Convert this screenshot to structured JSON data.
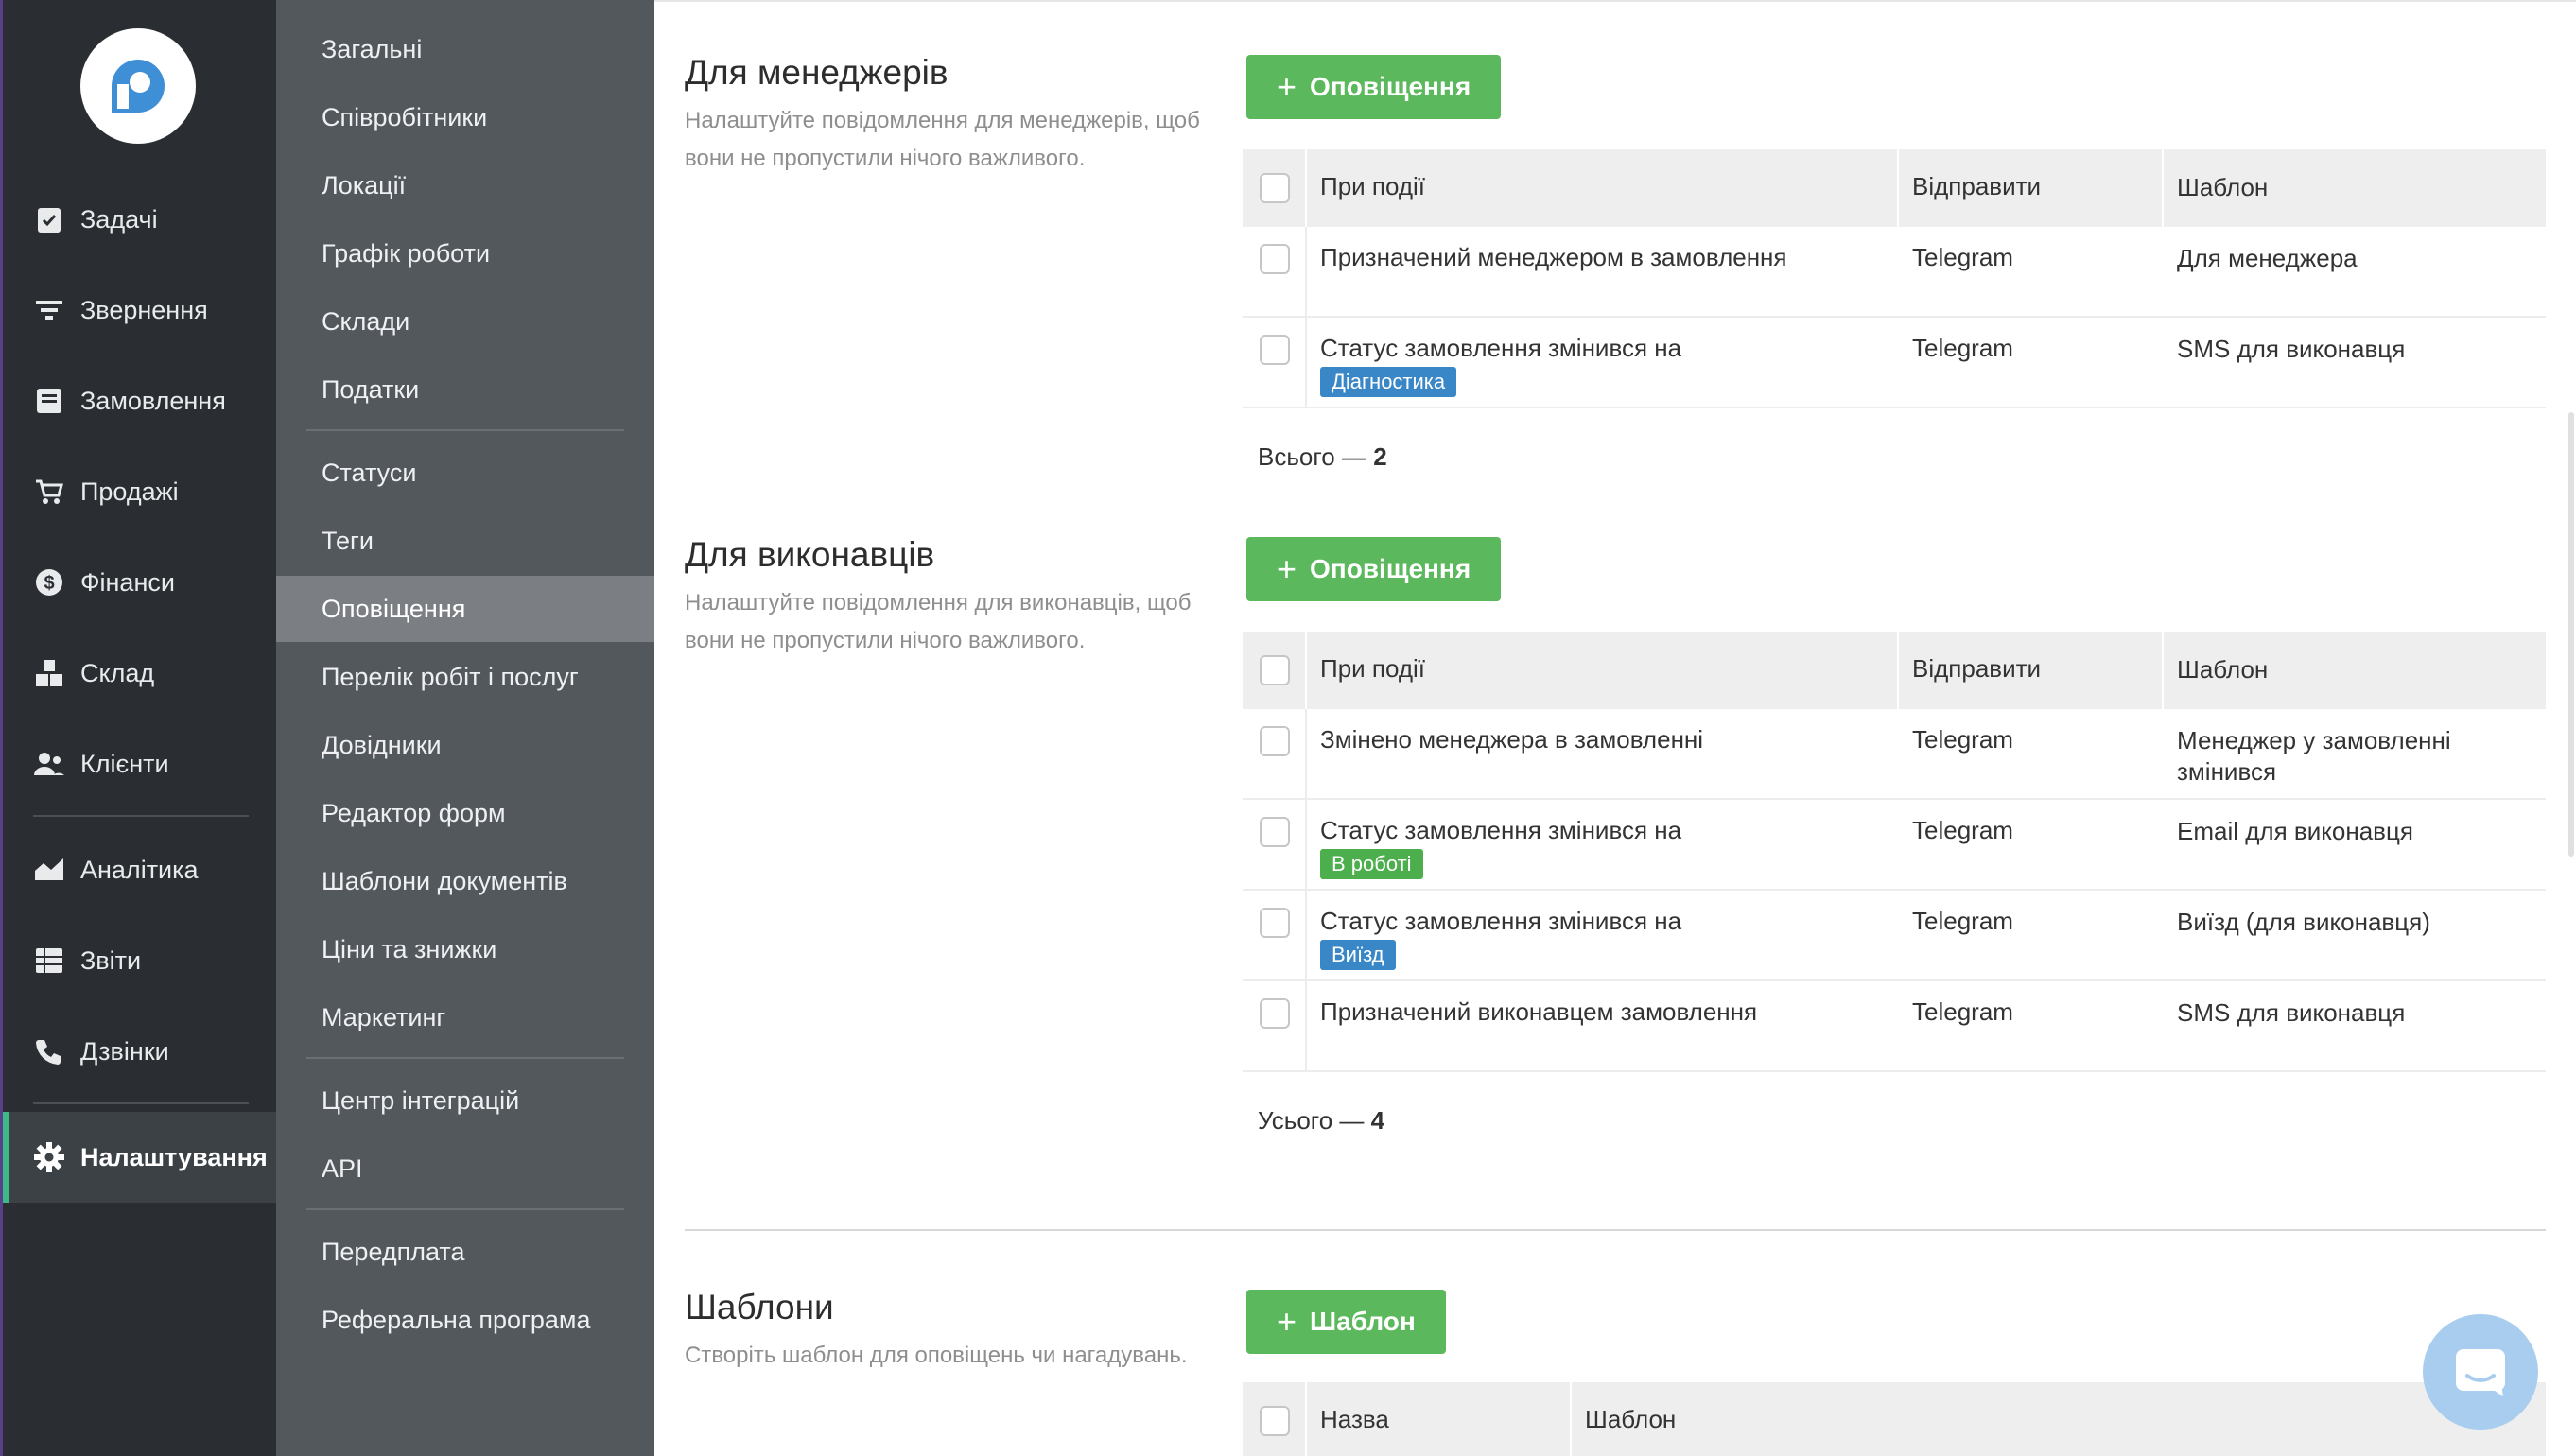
{
  "nav": {
    "items": [
      {
        "label": "Задачі",
        "icon": "tasks-icon"
      },
      {
        "label": "Звернення",
        "icon": "filter-icon"
      },
      {
        "label": "Замовлення",
        "icon": "orders-icon"
      },
      {
        "label": "Продажі",
        "icon": "cart-icon"
      },
      {
        "label": "Фінанси",
        "icon": "dollar-icon"
      },
      {
        "label": "Склад",
        "icon": "warehouse-icon"
      },
      {
        "label": "Клієнти",
        "icon": "clients-icon"
      },
      {
        "label": "Аналітика",
        "icon": "analytics-icon"
      },
      {
        "label": "Звіти",
        "icon": "reports-icon"
      },
      {
        "label": "Дзвінки",
        "icon": "phone-icon"
      },
      {
        "label": "Налаштування",
        "icon": "gear-icon"
      }
    ],
    "active": "Налаштування"
  },
  "submenu": {
    "items": [
      "Загальні",
      "Співробітники",
      "Локації",
      "Графік роботи",
      "Склади",
      "Податки",
      "Статуси",
      "Теги",
      "Оповіщення",
      "Перелік робіт і послуг",
      "Довідники",
      "Редактор форм",
      "Шаблони документів",
      "Ціни та знижки",
      "Маркетинг",
      "Центр інтеграцій",
      "API",
      "Передплата",
      "Реферальна програма"
    ],
    "active": "Оповіщення"
  },
  "managers": {
    "title": "Для менеджерів",
    "description": "Налаштуйте повідомлення для менеджерів, щоб вони не пропустили нічого важливого.",
    "add_label": "Оповіщення",
    "headers": {
      "event": "При події",
      "send": "Відправити",
      "template": "Шаблон"
    },
    "rows": [
      {
        "event": "Призначений менеджером в замовлення",
        "badge": "",
        "send": "Telegram",
        "template": "Для менеджера"
      },
      {
        "event": "Статус замовлення змінився на",
        "badge": "Діагностика",
        "send": "Telegram",
        "template": "SMS для виконавця"
      }
    ],
    "total_label": "Всього —",
    "total_count": "2"
  },
  "executors": {
    "title": "Для виконавців",
    "description": "Налаштуйте повідомлення для виконавців, щоб вони не пропустили нічого важливого.",
    "add_label": "Оповіщення",
    "headers": {
      "event": "При події",
      "send": "Відправити",
      "template": "Шаблон"
    },
    "rows": [
      {
        "event": "Змінено менеджера в замовленні",
        "badge": "",
        "send": "Telegram",
        "template": "Менеджер у замовленні змінився"
      },
      {
        "event": "Статус замовлення змінився на",
        "badge": "В роботі",
        "send": "Telegram",
        "template": "Email для виконавця"
      },
      {
        "event": "Статус замовлення змінився на",
        "badge": "Виїзд",
        "send": "Telegram",
        "template": "Виїзд (для виконавця)"
      },
      {
        "event": "Призначений виконавцем замовлення",
        "badge": "",
        "send": "Telegram",
        "template": "SMS для виконавця"
      }
    ],
    "total_label": "Усього —",
    "total_count": "4"
  },
  "templates": {
    "title": "Шаблони",
    "description": "Створіть шаблон для оповіщень чи нагадувань.",
    "add_label": "Шаблон",
    "headers": {
      "name": "Назва",
      "template": "Шаблон"
    }
  },
  "colors": {
    "accent_green": "#5cb85c",
    "badge_diagnostics": "#3a87c8",
    "badge_in_work": "#4cae4c",
    "badge_visit": "#3a87c8"
  }
}
